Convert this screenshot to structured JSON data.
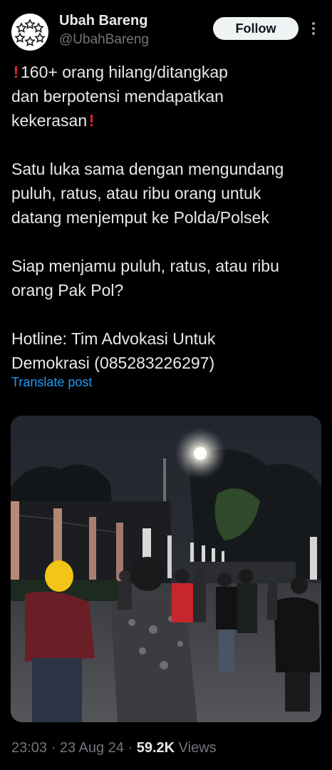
{
  "author": {
    "display_name": "Ubah Bareng",
    "handle": "@UbahBareng",
    "follow_label": "Follow"
  },
  "icons": {
    "avatar": "star-ring-logo-icon",
    "more": "more-vertical-icon",
    "alert": "red-exclamation-emoji-icon"
  },
  "post": {
    "paragraph1": {
      "lines": [
        "160+ orang hilang/ditangkap",
        "dan berpotensi mendapatkan",
        "kekerasan"
      ]
    },
    "paragraph2": {
      "lines": [
        "Satu luka sama dengan mengundang",
        "puluh, ratus, atau ribu orang untuk",
        "datang menjemput ke Polda/Polsek"
      ]
    },
    "paragraph3": {
      "lines": [
        "Siap menjamu puluh, ratus, atau ribu",
        "orang Pak Pol?"
      ]
    },
    "paragraph4": {
      "lines": [
        "Hotline: Tim Advokasi Untuk",
        "Demokrasi (085283226297)"
      ]
    },
    "translate_label": "Translate post"
  },
  "meta": {
    "time": "23:03",
    "sep1": " · ",
    "date": "23 Aug 24",
    "sep2": " · ",
    "views_count": "59.2K",
    "views_label": " Views"
  },
  "colors": {
    "background": "#000000",
    "text": "#e7e9ea",
    "secondary": "#71767b",
    "link": "#1d9bf0",
    "alert": "#e0242b"
  }
}
